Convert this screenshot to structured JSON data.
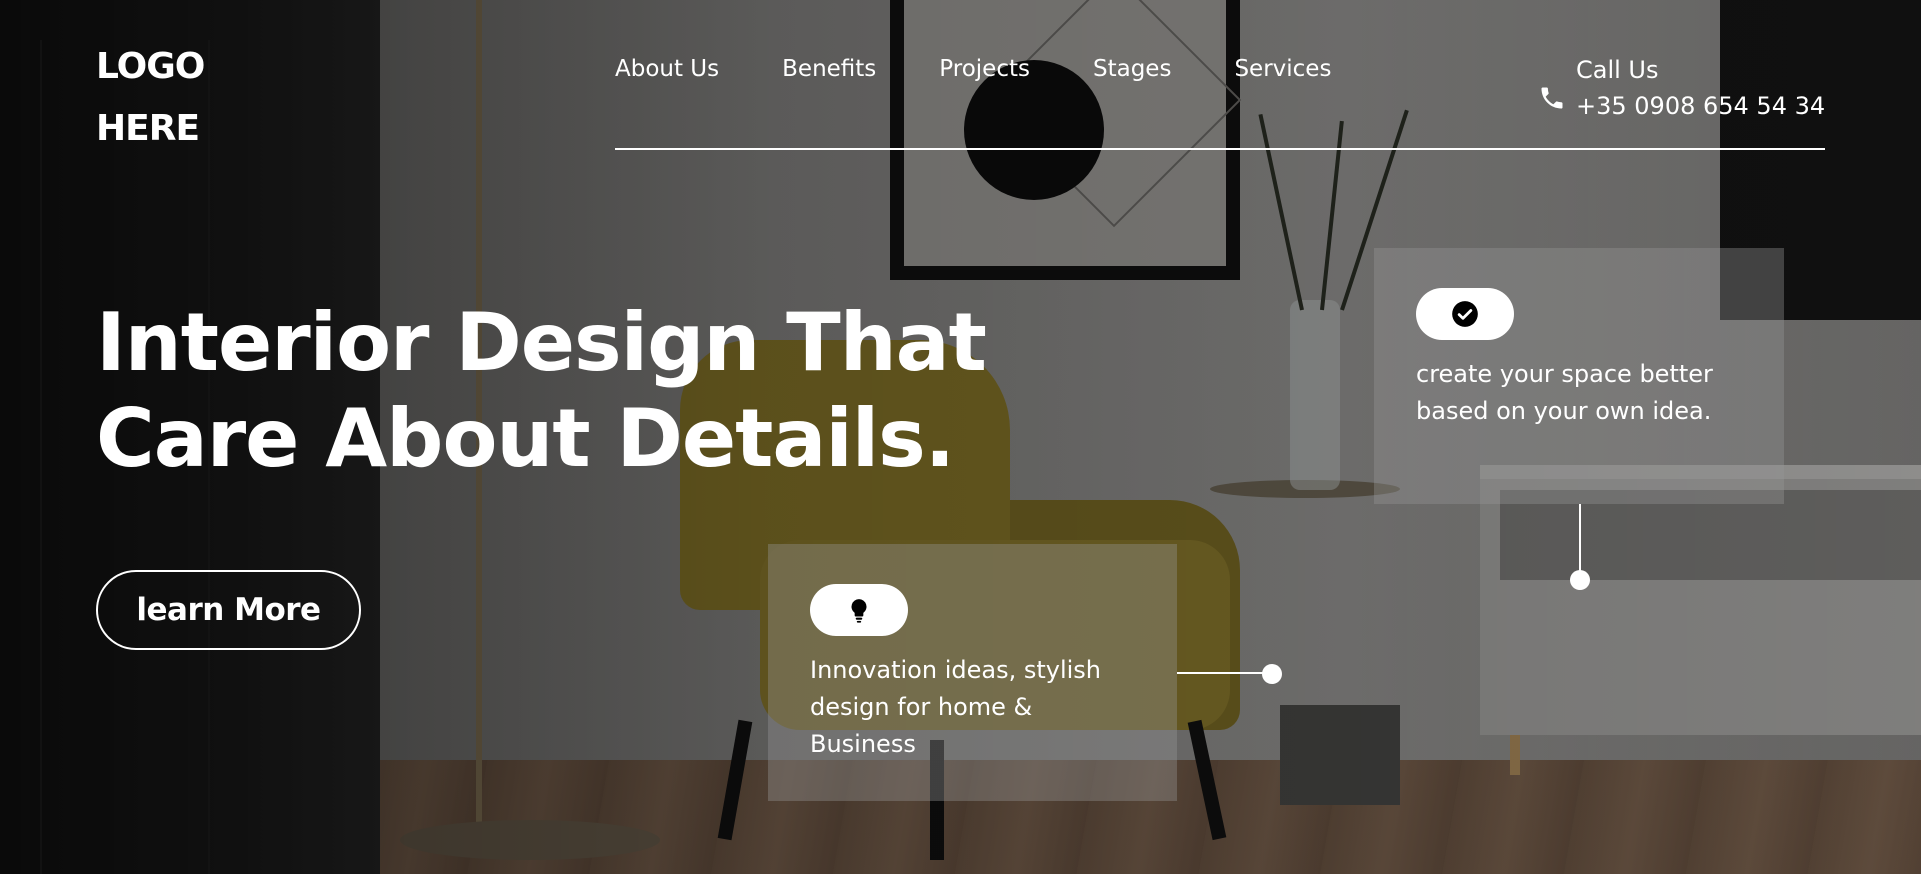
{
  "logo": {
    "line1": "LOGO",
    "line2": "HERE"
  },
  "nav": {
    "items": [
      {
        "label": "About Us"
      },
      {
        "label": "Benefits"
      },
      {
        "label": "Projects"
      },
      {
        "label": "Stages"
      },
      {
        "label": "Services"
      }
    ]
  },
  "contact": {
    "label": "Call Us",
    "phone": "+35 0908 654 54 34",
    "icon": "phone-icon"
  },
  "hero": {
    "headline_line1": "Interior Design That",
    "headline_line2": "Care About Details.",
    "cta_label": "learn More"
  },
  "features": [
    {
      "icon": "lightbulb-icon",
      "text": "Innovation ideas, stylish design for home & Business"
    },
    {
      "icon": "check-circle-icon",
      "text": "create your space better based on your own idea."
    }
  ],
  "colors": {
    "text": "#ffffff",
    "card_bg": "rgba(150,150,150,0.38)",
    "pill_bg": "#ffffff",
    "icon": "#000000"
  }
}
